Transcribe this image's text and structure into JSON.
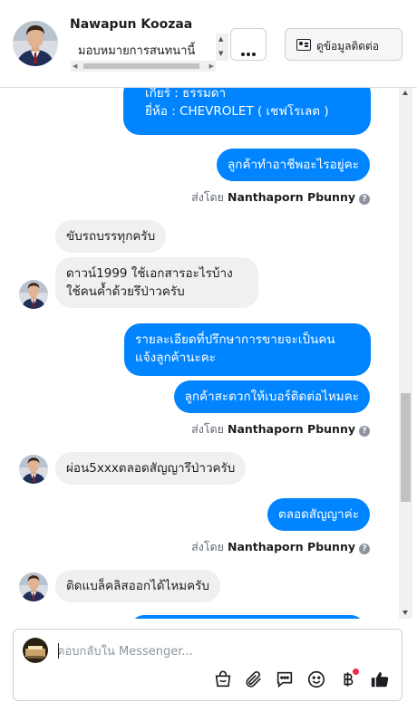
{
  "header": {
    "contact_name": "Nawapun Koozaa",
    "assign_label": "มอบหมายการสนทนานี้",
    "more_label": "...",
    "contact_info_label": "ดูข้อมูลติดต่อ"
  },
  "messages": {
    "top_bubble": {
      "line1": "เกียร์ : ธรรมดา",
      "line2": "ยี่ห้อ : CHEVROLET ( เชฟโรเลต )"
    },
    "m1": "ลูกค้าทำอาชีพอะไรอยู่คะ",
    "sent1": {
      "prefix": "ส่งโดย ",
      "name": "Nanthaporn Pbunny"
    },
    "m2": "ขับรถบรรทุกครับ",
    "m3": {
      "line1": "ดาวน์1999 ใช้เอกสารอะไรบ้าง",
      "line2": "ใช้คนค้ำด้วยรึป่าวครับ"
    },
    "m4": {
      "line1": "รายละเอียดที่ปรึกษาการขายจะเป็นคน",
      "line2": "แจ้งลูกค้านะคะ"
    },
    "m5": "ลูกค้าสะดวกให้เบอร์ติดต่อไหมคะ",
    "sent2": {
      "prefix": "ส่งโดย ",
      "name": "Nanthaporn Pbunny"
    },
    "m6": "ผ่อน5xxxตลอดสัญญารึป่าวครับ",
    "m7": "ตลอดสัญญาค่ะ",
    "sent3": {
      "prefix": "ส่งโดย ",
      "name": "Nanthaporn Pbunny"
    },
    "m8": "ติดแบล็คลิสออกได้ไหมครับ",
    "info_glyph": "?"
  },
  "composer": {
    "placeholder": "ตอบกลับใน Messenger..."
  },
  "colors": {
    "outgoing": "#0084ff",
    "incoming": "#f0f0f0",
    "like": "#0084ff",
    "notification": "#f02849"
  },
  "icons": [
    "shopping-bag-icon",
    "paperclip-icon",
    "saved-replies-icon",
    "emoji-icon",
    "baht-payment-icon",
    "thumbs-up-icon",
    "contact-card-icon",
    "more-dots-icon",
    "question-icon"
  ]
}
